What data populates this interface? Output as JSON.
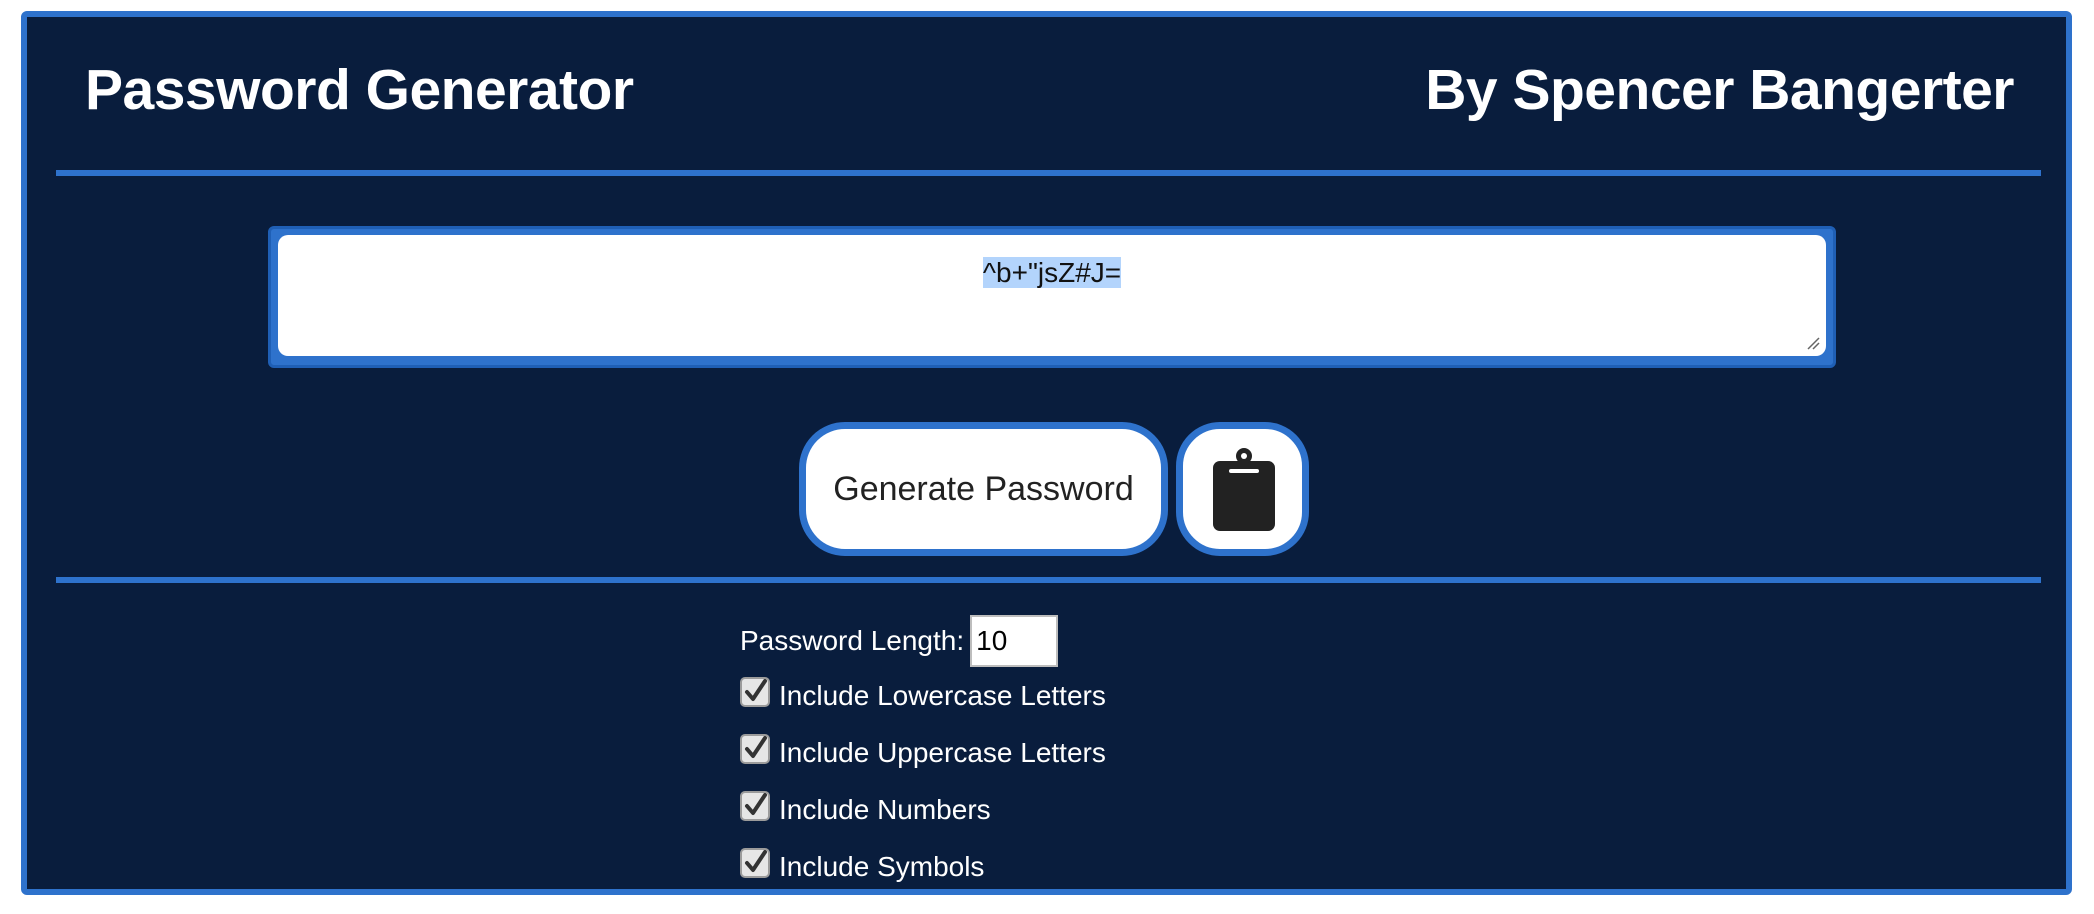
{
  "header": {
    "title": "Password Generator",
    "author": "By Spencer Bangerter"
  },
  "output": {
    "password": "^b+\"jsZ#J="
  },
  "buttons": {
    "generate_label": "Generate Password",
    "copy_icon": "clipboard-icon"
  },
  "options": {
    "length_label": "Password Length:",
    "length_value": "10",
    "checkboxes": [
      {
        "label": "Include Lowercase Letters",
        "checked": true
      },
      {
        "label": "Include Uppercase Letters",
        "checked": true
      },
      {
        "label": "Include Numbers",
        "checked": true
      },
      {
        "label": "Include Symbols",
        "checked": true
      }
    ]
  },
  "colors": {
    "background": "#091d3d",
    "accent": "#2e72cc",
    "text": "#ffffff"
  }
}
